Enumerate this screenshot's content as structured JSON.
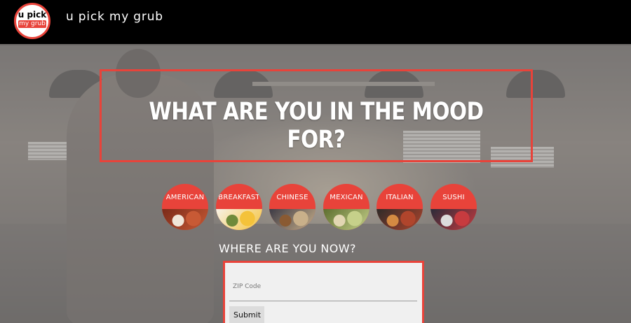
{
  "brand": {
    "logo_top": "u pick",
    "logo_bottom": "my grub",
    "name": "u pick my grub"
  },
  "hero": {
    "title": "WHAT ARE YOU IN THE MOOD FOR?"
  },
  "cuisines": [
    {
      "label": "AMERICAN",
      "photo_colors": [
        "#7a2a18",
        "#c85a35",
        "#f0e6d8"
      ]
    },
    {
      "label": "BREAKFAST",
      "photo_colors": [
        "#f7f2e8",
        "#f4c23a",
        "#6f8a3a"
      ]
    },
    {
      "label": "CHINESE",
      "photo_colors": [
        "#3c3a45",
        "#c9b08a",
        "#8a5a32"
      ]
    },
    {
      "label": "MEXICAN",
      "photo_colors": [
        "#5d6e2f",
        "#c6d08a",
        "#e2d6b2"
      ]
    },
    {
      "label": "ITALIAN",
      "photo_colors": [
        "#2d2a29",
        "#b0452c",
        "#d48a42"
      ]
    },
    {
      "label": "SUSHI",
      "photo_colors": [
        "#2a2b3a",
        "#c73b3f",
        "#dcdcdc"
      ]
    }
  ],
  "location": {
    "title": "WHERE ARE YOU NOW?",
    "zip_placeholder": "ZIP Code",
    "submit_label": "Submit"
  },
  "colors": {
    "accent": "#e8433a",
    "navbar": "#000000",
    "overlay": "#969696"
  }
}
